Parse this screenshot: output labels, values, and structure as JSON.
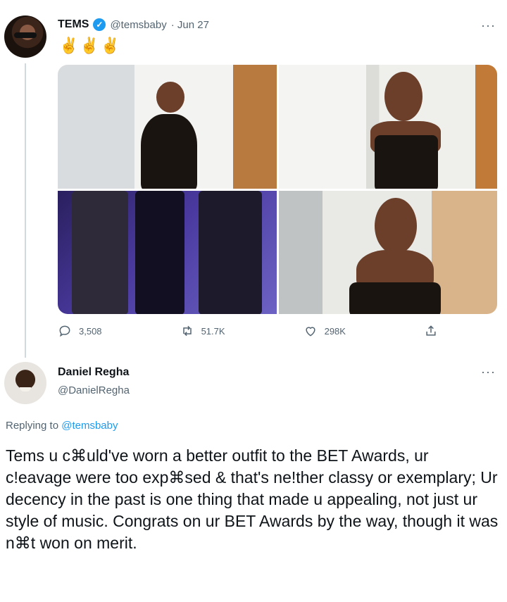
{
  "tweet1": {
    "name": "TEMS",
    "handle": "@temsbaby",
    "date": "· Jun 27",
    "emojis": "✌✌✌",
    "verified_icon": "checkmark",
    "stats": {
      "replies": "3,508",
      "retweets": "51.7K",
      "likes": "298K"
    }
  },
  "tweet2": {
    "name": "Daniel Regha",
    "handle": "@DanielRegha",
    "replying_prefix": "Replying to",
    "replying_handle": "@temsbaby",
    "text": "Tems u c⌘uld've worn a better outfit to the BET Awards, ur c!eavage were too exp⌘sed & that's ne!ther classy or exemplary; Ur decency in the past is one thing that made u appealing, not just ur style of music. Congrats on ur BET Awards by the way, though it was n⌘t won on merit."
  },
  "more_icon": "···",
  "colors": {
    "accent": "#1d9bf0",
    "muted": "#536471",
    "text": "#0f1419"
  }
}
